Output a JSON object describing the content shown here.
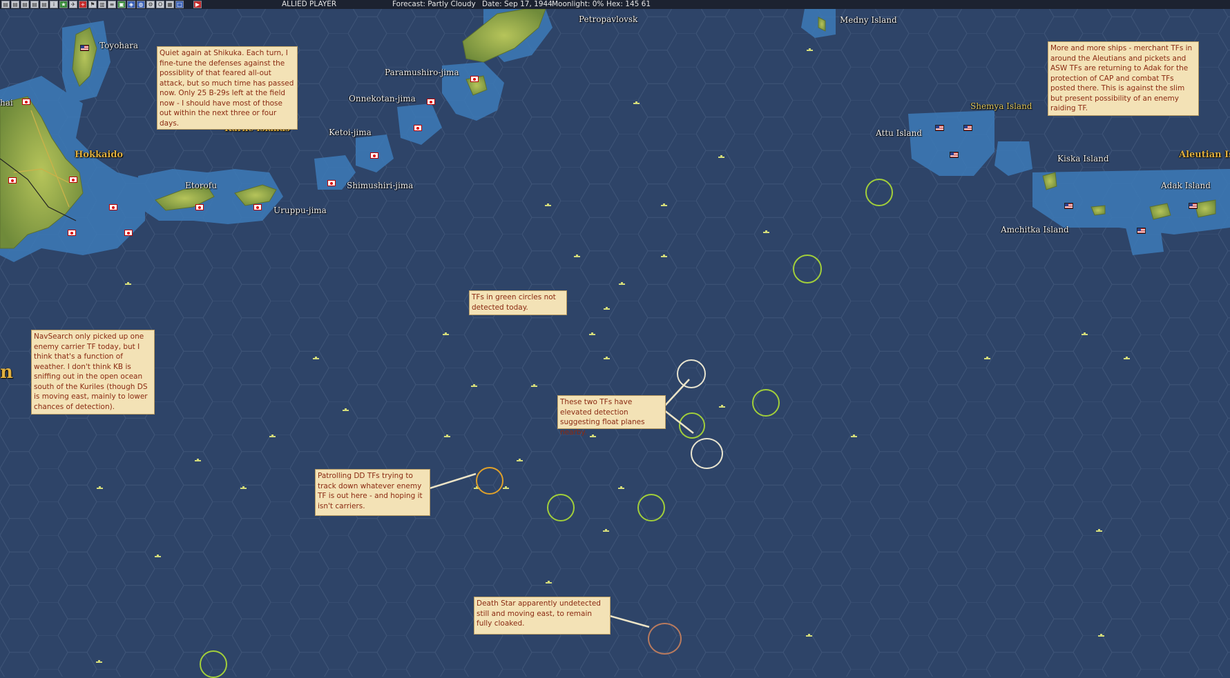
{
  "topbar": {
    "side": "ALLIED PLAYER",
    "forecast": "Forecast: Partly Cloudy",
    "date": "Date: Sep 17, 1944",
    "moonlight": "Moonlight: 0%",
    "hex": "Hex: 145 61",
    "icons": [
      "report-icon",
      "report-icon",
      "report-icon",
      "report-icon",
      "report-icon",
      "info-icon",
      "star-icon",
      "aircraft-icon",
      "cross-icon",
      "flag-icon",
      "base-icon",
      "list-icon",
      "unit-icon",
      "map-icon",
      "globe-icon",
      "settings-icon",
      "ob-icon",
      "log-icon",
      "window-icon",
      "end-turn-icon"
    ]
  },
  "places": {
    "toyohara": "Toyohara",
    "petropavlovsk": "Petropavlovsk",
    "medny": "Medny Island",
    "paramushiro": "Paramushiro-jima",
    "onnekotan": "Onnekotan-jima",
    "ketoi": "Ketoi-jima",
    "kurile": "Kurile Islands",
    "hokkaido": "Hokkaido",
    "etorofu": "Etorofu",
    "shimushiri": "Shimushiri-jima",
    "uruppu": "Uruppu-jima",
    "shemya": "Shemya Island",
    "attu": "Attu Island",
    "kiska": "Kiska Island",
    "aleutian": "Aleutian Is",
    "adak": "Adak Island",
    "amchitka": "Amchitka Island",
    "edge_left": "hai",
    "edge_n": "n"
  },
  "notes": {
    "shikuka": "Quiet again at Shikuka.  Each turn, I fine-tune the defenses against the possiblity of that feared all-out attack, but so much time has passed now.  Only 25 B-29s left at the field now - I should have most of those out within the next three or four days.",
    "aleutians": "More and more ships - merchant TFs in around the Aleutians and pickets and ASW TFs are returning to Adak for the protection of CAP and combat TFs posted there.  This is against the slim but present possibility of an enemy raiding TF.",
    "green_circles": "TFs in green circles not detected today.",
    "navsearch": "NavSearch only picked up one enemy carrier TF today, but I think that's a function of weather.  I don't think KB is sniffing out in the open ocean south of the Kuriles (though DS is moving east, mainly to lower chances of detection).",
    "elevated": "These two TFs have elevated detection suggesting float planes nearby.",
    "patrolling": "Patrolling DD TFs trying to track down whatever enemy TF is out here - and hoping it isn't carriers.",
    "deathstar": "Death Star apparently undetected still and moving east, to remain fully cloaked."
  },
  "colors": {
    "ocean": "#2e4468",
    "shallow": "#3c78b4",
    "land": "#8fa44a",
    "ring_green": "#a2cf3a",
    "ring_white": "#e8e4cf",
    "ring_orange": "#e0a12a",
    "ring_brown": "#b87a5e",
    "note_bg": "#f3e2b6",
    "note_text": "#8a2a12"
  }
}
